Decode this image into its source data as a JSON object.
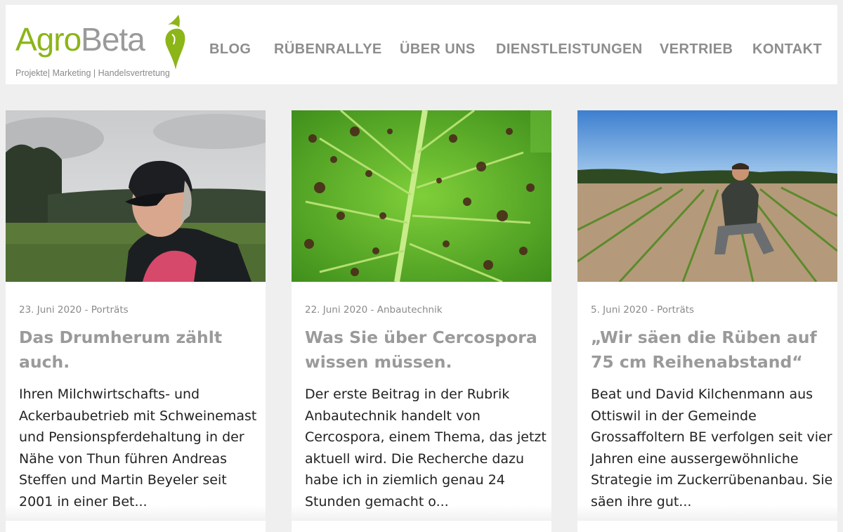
{
  "logo": {
    "brand_part1": "Agro",
    "brand_part2": "Beta",
    "tagline": "Projekte| Marketing | Handelsvertretung",
    "icon": "beet-icon",
    "colors": {
      "green": "#8cb518",
      "grey": "#9a9a9a"
    }
  },
  "nav": {
    "items": [
      {
        "label": "BLOG"
      },
      {
        "label": "RÜBENRALLYE"
      },
      {
        "label": "ÜBER UNS"
      },
      {
        "label": "DIENSTLEISTUNGEN"
      },
      {
        "label": "VERTRIEB"
      },
      {
        "label": "KONTAKT"
      }
    ]
  },
  "posts": [
    {
      "date": "23. Juni 2020",
      "category": "Porträts",
      "title": "Das Drumherum zählt auch.",
      "excerpt": "Ihren Milchwirtschafts- und Ackerbaubetrieb mit Schweinemast und Pensionspferdehaltung in der Nähe von Thun führen Andreas Steffen und Martin Beyeler seit 2001 in einer Bet..."
    },
    {
      "date": "22. Juni 2020",
      "category": "Anbautechnik",
      "title": "Was Sie über Cercospora wissen müssen.",
      "excerpt": "Der erste Beitrag in der Rubrik Anbautechnik handelt von Cercospora, einem Thema, das jetzt aktuell wird. Die Recherche dazu habe ich in ziemlich genau 24 Stunden gemacht o..."
    },
    {
      "date": "5. Juni 2020",
      "category": "Porträts",
      "title": "„Wir säen die Rüben auf 75 cm Reihenabstand“",
      "excerpt": "Beat und David Kilchenmann aus Ottiswil in der Gemeinde Grossaffoltern BE verfolgen seit vier Jahren eine aussergewöhnliche Strategie im Zuckerrübenanbau. Sie säen ihre gut..."
    }
  ]
}
